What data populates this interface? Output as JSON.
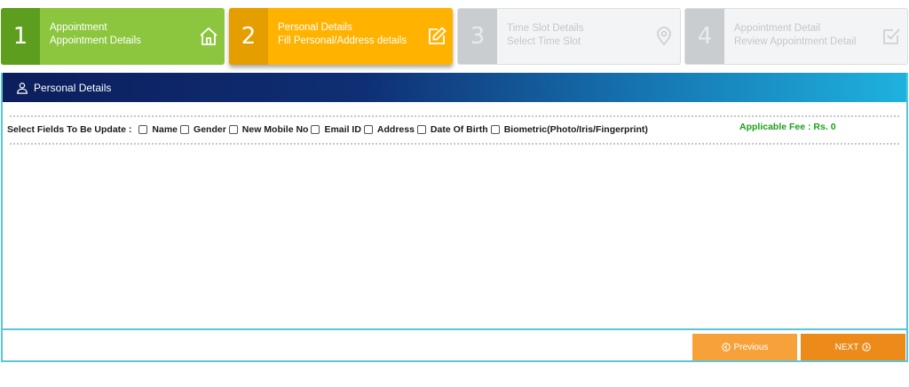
{
  "steps": [
    {
      "number": "1",
      "title": "Appointment",
      "subtitle": "Appointment Details",
      "icon": "home-icon",
      "state": "done"
    },
    {
      "number": "2",
      "title": "Personal Details",
      "subtitle": "Fill Personal/Address details",
      "icon": "edit-icon",
      "state": "active"
    },
    {
      "number": "3",
      "title": "Time Slot Details",
      "subtitle": "Select Time Slot",
      "icon": "location-pin-icon",
      "state": "disabled"
    },
    {
      "number": "4",
      "title": "Appointment Detail",
      "subtitle": "Review Appointment Detail",
      "icon": "checkbox-icon",
      "state": "disabled"
    }
  ],
  "panel": {
    "title": "Personal Details",
    "icon": "user-icon"
  },
  "fields": {
    "lead_label": "Select Fields To Be Update :",
    "options": [
      "Name",
      "Gender",
      "New Mobile No",
      "Email ID",
      "Address",
      "Date Of Birth",
      "Biometric(Photo/Iris/Fingerprint)"
    ],
    "fee_label": "Applicable Fee : Rs. 0"
  },
  "buttons": {
    "previous_label": "Previous",
    "next_label": "NEXT"
  },
  "colors": {
    "step_done": "#8cc63f",
    "step_active": "#ffb300",
    "step_disabled": "#f3f4f5",
    "header_dark": "#0c1e5c",
    "header_light": "#1fb2de",
    "fee_green": "#1aa01a",
    "button_orange": "#ec8a1a"
  }
}
